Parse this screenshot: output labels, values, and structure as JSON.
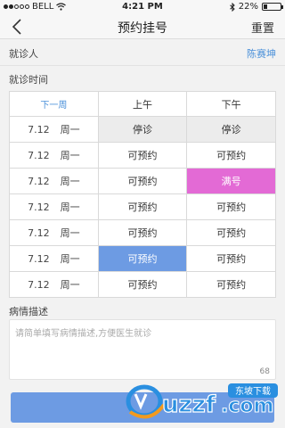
{
  "status_bar": {
    "carrier": "BELL",
    "time": "4:21 PM",
    "battery_percent": "22%",
    "battery_level": 0.22
  },
  "nav": {
    "title": "预约挂号",
    "reset_label": "重置"
  },
  "patient": {
    "label": "就诊人",
    "name": "陈赛坤"
  },
  "schedule": {
    "section_label": "就诊时间",
    "prev_week_label": "下一周",
    "morning_label": "上午",
    "afternoon_label": "下午",
    "rows": [
      {
        "date": "7.12",
        "weekday": "周一",
        "am": "停诊",
        "pm": "停诊"
      },
      {
        "date": "7.12",
        "weekday": "周一",
        "am": "可预约",
        "pm": "可预约"
      },
      {
        "date": "7.12",
        "weekday": "周一",
        "am": "可预约",
        "pm": "满号"
      },
      {
        "date": "7.12",
        "weekday": "周一",
        "am": "可预约",
        "pm": "可预约"
      },
      {
        "date": "7.12",
        "weekday": "周一",
        "am": "可预约",
        "pm": "可预约"
      },
      {
        "date": "7.12",
        "weekday": "周一",
        "am": "可预约",
        "pm": "可预约"
      },
      {
        "date": "7.12",
        "weekday": "周一",
        "am": "可预约",
        "pm": "可预约"
      }
    ]
  },
  "description": {
    "section_label": "病情描述",
    "placeholder": "请简单填写病情描述,方便医生就诊",
    "char_count": "68"
  },
  "watermark": {
    "brand": "uzzf.com",
    "tag": "东坡下载"
  },
  "colors": {
    "accent_blue": "#6d9be3",
    "full_pink": "#e36ad5",
    "link_blue": "#4a90d9"
  }
}
